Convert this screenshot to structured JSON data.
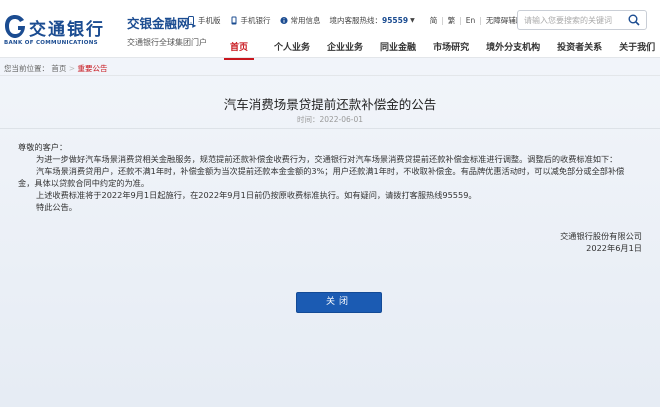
{
  "header": {
    "logo_cn": "交通银行",
    "logo_en": "BANK OF COMMUNICATIONS",
    "brand_name": "交银金融网",
    "brand_sub": "交通银行全球集团门户",
    "toplinks": {
      "mobile_web": "手机版",
      "mobile_bank": "手机银行",
      "common_info": "常用信息",
      "hotline_label": "境内客服热线：",
      "hotline_number": "95559",
      "lang_simplified": "简",
      "lang_traditional": "繁",
      "lang_english": "En",
      "accessible": "无障碍辅助浏览"
    },
    "search_placeholder": "请输入您要搜索的关键词",
    "nav": [
      "首页",
      "个人业务",
      "企业业务",
      "同业金融",
      "市场研究",
      "境外分支机构",
      "投资者关系",
      "关于我们"
    ]
  },
  "breadcrumb": {
    "label": "您当前位置：",
    "home": "首页",
    "current": "重要公告"
  },
  "article": {
    "title": "汽车消费场景贷提前还款补偿金的公告",
    "date": "时间：2022-06-01",
    "salutation": "尊敬的客户：",
    "lines": [
      "为进一步做好汽车场景消费贷相关金融服务，规范提前还款补偿金收费行为，交通银行对汽车场景消费贷提前还款补偿金标准进行调整。调整后的收费标准如下：",
      "汽车场景消费贷用户，还款不满1年时，补偿金额为当次提前还款本金金额的3%；用户还款满1年时，不收取补偿金。有品牌优惠活动时，可以减免部分或全部补偿",
      "金，具体以贷款合同中约定的为准。",
      "上述收费标准将于2022年9月1日起施行，在2022年9月1日前仍按原收费标准执行。如有疑问，请拨打客服热线95559。",
      "特此公告。"
    ],
    "signature": "交通银行股份有限公司",
    "sign_date": "2022年6月1日"
  },
  "close_label": "关闭",
  "colors": {
    "brand_blue": "#1b4c91",
    "active_red": "#c8161d",
    "button_blue": "#1b5bb3"
  }
}
